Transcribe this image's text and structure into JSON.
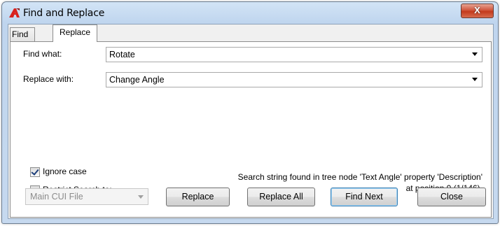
{
  "window": {
    "title": "Find and Replace",
    "close_glyph": "X"
  },
  "tabs": [
    {
      "label": "Find"
    },
    {
      "label": "Replace",
      "active": true
    }
  ],
  "form": {
    "find_label": "Find what:",
    "find_value": "Rotate",
    "replace_label": "Replace with:",
    "replace_value": "Change Angle"
  },
  "options": {
    "ignore_case": {
      "label": "Ignore case",
      "checked": true
    },
    "restrict": {
      "label": "Restrict Search to:",
      "checked": false
    },
    "scope_value": "Main CUI File"
  },
  "status": {
    "line1": "Search string found in tree node 'Text Angle' property 'Description'",
    "line2": "at position 0 (1/146)."
  },
  "buttons": {
    "replace": "Replace",
    "replace_all": "Replace All",
    "find_next": "Find Next",
    "close": "Close"
  },
  "colors": {
    "accent": "#3c7fb1",
    "close": "#c33a1c"
  },
  "icons": {
    "app": "autocad-a-icon",
    "close": "close-icon"
  }
}
